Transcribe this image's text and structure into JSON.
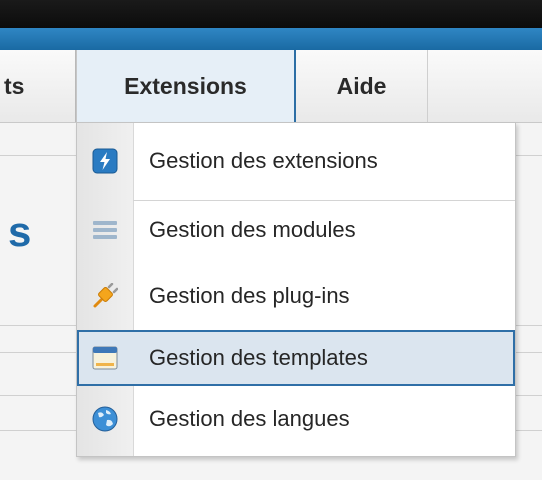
{
  "menu": {
    "prev_tab_fragment": "ts",
    "tabs": [
      {
        "label": "Extensions",
        "active": true
      },
      {
        "label": "Aide",
        "active": false
      }
    ]
  },
  "content": {
    "title_fragment": "s"
  },
  "dropdown": {
    "items": [
      {
        "label": "Gestion des extensions",
        "icon": "extension-manager-icon",
        "highlighted": false
      },
      {
        "label": "Gestion des modules",
        "icon": "modules-icon",
        "highlighted": false
      },
      {
        "label": "Gestion des plug-ins",
        "icon": "plugin-icon",
        "highlighted": false
      },
      {
        "label": "Gestion des templates",
        "icon": "templates-icon",
        "highlighted": true
      },
      {
        "label": "Gestion des langues",
        "icon": "globe-icon",
        "highlighted": false
      }
    ]
  },
  "colors": {
    "top_bar": "#111111",
    "blue_bar": "#1f74b3",
    "accent_border": "#2f6fa7",
    "title_blue": "#1f6aa9",
    "highlight_bg": "#dbe5ef"
  }
}
